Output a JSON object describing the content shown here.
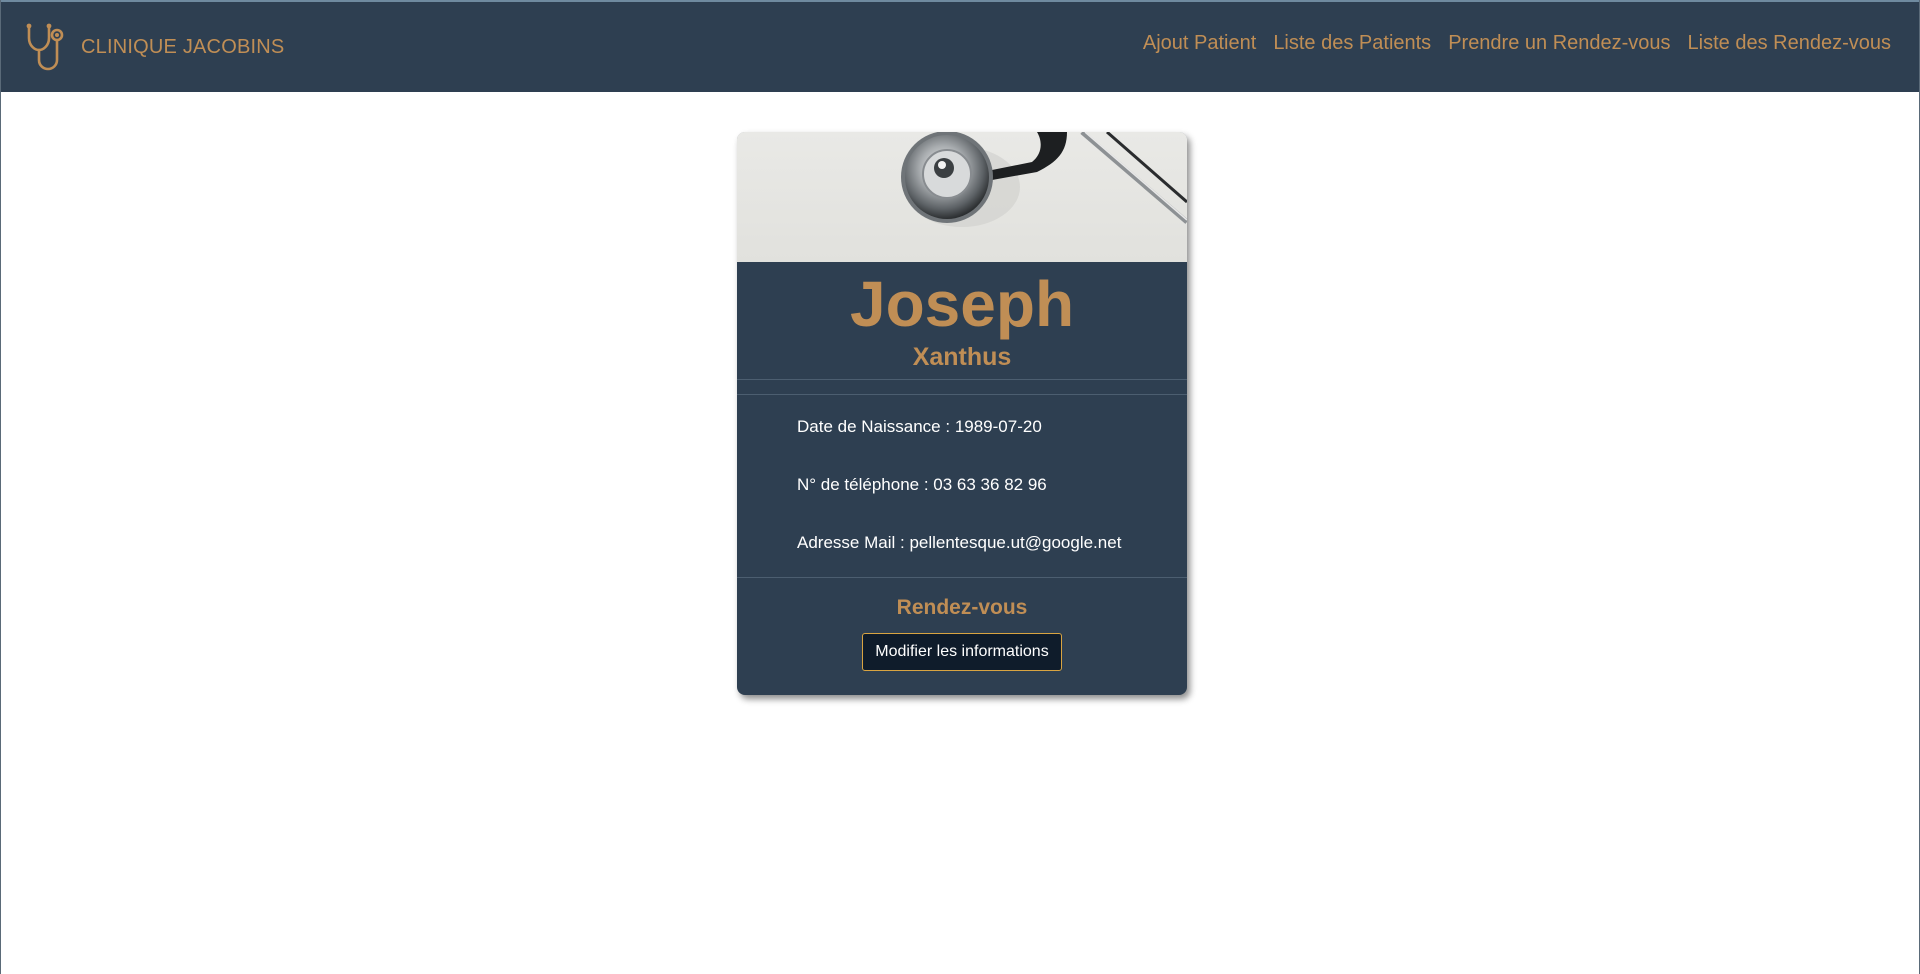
{
  "navbar": {
    "brand": "CLINIQUE JACOBINS",
    "brand_icon": "stethoscope-icon",
    "links": [
      {
        "label": "Ajout Patient"
      },
      {
        "label": "Liste des Patients"
      },
      {
        "label": "Prendre un Rendez-vous"
      },
      {
        "label": "Liste des Rendez-vous"
      }
    ]
  },
  "patient": {
    "first_name": "Joseph",
    "last_name": "Xanthus",
    "birth_label": "Date de Naissance : ",
    "birth_date": "1989-07-20",
    "phone_label": "N° de téléphone : ",
    "phone": "03 63 36 82 96",
    "email_label": "Adresse Mail : ",
    "email": "pellentesque.ut@google.net"
  },
  "rdv": {
    "title": "Rendez-vous",
    "edit_label": "Modifier les informations"
  },
  "colors": {
    "navbar_bg": "#2e3f51",
    "accent": "#c08e55",
    "card_bg": "#2e3f51",
    "button_border": "#d9a441"
  }
}
